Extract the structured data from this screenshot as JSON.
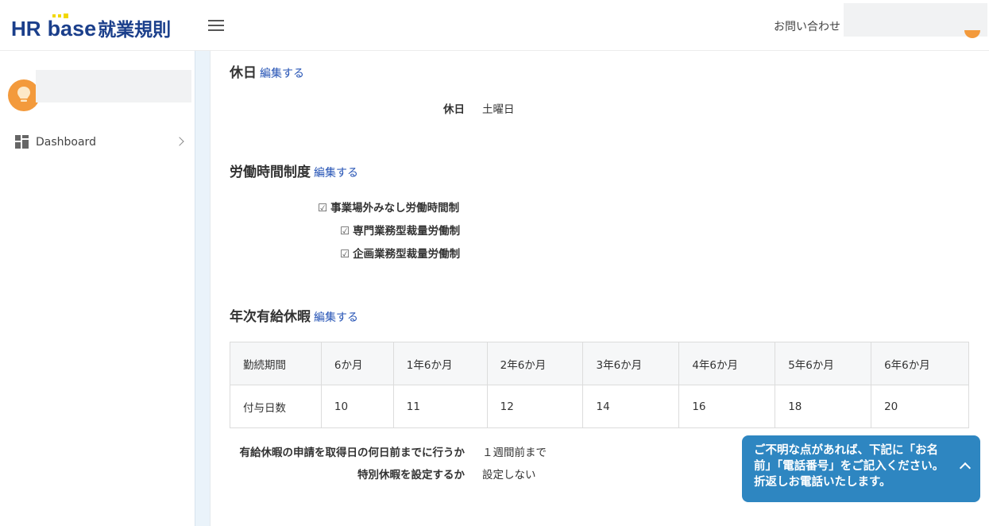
{
  "header": {
    "logo_hr": "HR",
    "logo_base": "base",
    "logo_ja": "就業規則",
    "contact_label": "お問い合わせ"
  },
  "sidebar": {
    "items": [
      {
        "label": "Dashboard",
        "icon": "dashboard-grid-icon"
      }
    ]
  },
  "holiday": {
    "title": "休日",
    "edit_label": "編集する",
    "label": "休日",
    "value": "土曜日"
  },
  "work_system": {
    "title": "労働時間制度",
    "edit_label": "編集する",
    "check_glyph": "☑",
    "items": [
      "事業場外みなし労働時間制",
      "専門業務型裁量労働制",
      "企画業務型裁量労働制"
    ]
  },
  "paid_leave": {
    "title": "年次有給休暇",
    "edit_label": "編集する",
    "table": {
      "header": [
        "勤続期間",
        "6か月",
        "1年6か月",
        "2年6か月",
        "3年6か月",
        "4年6か月",
        "5年6か月",
        "6年6か月"
      ],
      "row": [
        "付与日数",
        "10",
        "11",
        "12",
        "14",
        "16",
        "18",
        "20"
      ]
    },
    "request_label": "有給休暇の申請を取得日の何日前までに行うか",
    "request_value": "１週間前まで",
    "special_label": "特別休暇を設定するか",
    "special_value": "設定しない"
  },
  "chat": {
    "message": "ご不明な点があれば、下記に「お名前」「電話番号」をご記入ください。折返しお電話いたします。"
  },
  "colors": {
    "brand": "#1b3f8b",
    "link": "#2553b5",
    "chat_bg": "#2e86c1",
    "avatar": "#f39a3c"
  }
}
